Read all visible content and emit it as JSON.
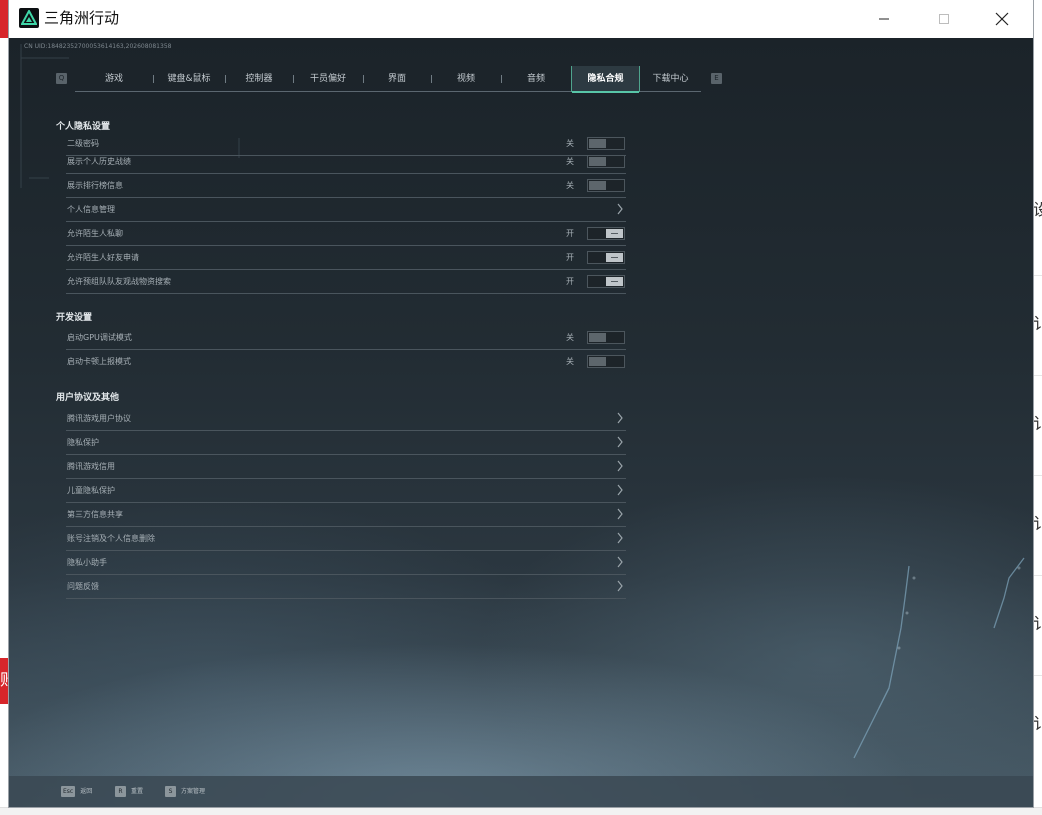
{
  "window": {
    "title": "三角洲行动",
    "uid_text": "CN UID:18482352700053614163,202608081358"
  },
  "background_app": {
    "left_glyph": "败",
    "right_glyphs": [
      "设",
      "讠",
      "讠",
      "讠",
      "讠",
      "讠"
    ]
  },
  "tabs": {
    "prev_key": "Q",
    "next_key": "E",
    "items": [
      {
        "label": "游戏"
      },
      {
        "label": "键盘&鼠标"
      },
      {
        "label": "控制器"
      },
      {
        "label": "干员偏好"
      },
      {
        "label": "界面"
      },
      {
        "label": "视频"
      },
      {
        "label": "音频"
      },
      {
        "label": "隐私合规",
        "active": true
      },
      {
        "label": "下载中心"
      }
    ]
  },
  "sections": {
    "privacy": {
      "title": "个人隐私设置",
      "rows": [
        {
          "label": "二级密码",
          "state": "关",
          "control": "toggle",
          "on": false
        },
        {
          "label": "展示个人历史战绩",
          "state": "关",
          "control": "toggle",
          "on": false
        },
        {
          "label": "展示排行榜信息",
          "state": "关",
          "control": "toggle",
          "on": false
        },
        {
          "label": "个人信息管理",
          "control": "link"
        },
        {
          "label": "允许陌生人私聊",
          "state": "开",
          "control": "toggle",
          "on": true
        },
        {
          "label": "允许陌生人好友申请",
          "state": "开",
          "control": "toggle",
          "on": true
        },
        {
          "label": "允许预组队队友观战物资搜索",
          "state": "开",
          "control": "toggle",
          "on": true
        }
      ]
    },
    "developer": {
      "title": "开发设置",
      "rows": [
        {
          "label": "启动GPU调试模式",
          "state": "关",
          "control": "toggle",
          "on": false
        },
        {
          "label": "启动卡顿上报模式",
          "state": "关",
          "control": "toggle",
          "on": false
        }
      ]
    },
    "agreements": {
      "title": "用户协议及其他",
      "rows": [
        {
          "label": "腾讯游戏用户协议",
          "control": "link"
        },
        {
          "label": "隐私保护",
          "control": "link"
        },
        {
          "label": "腾讯游戏信用",
          "control": "link"
        },
        {
          "label": "儿童隐私保护",
          "control": "link"
        },
        {
          "label": "第三方信息共享",
          "control": "link"
        },
        {
          "label": "账号注销及个人信息删除",
          "control": "link"
        },
        {
          "label": "隐私小助手",
          "control": "link"
        },
        {
          "label": "问题反馈",
          "control": "link"
        }
      ]
    }
  },
  "bottom_bar": {
    "hints": [
      {
        "key": "Esc",
        "label": "返回"
      },
      {
        "key": "R",
        "label": "重置"
      },
      {
        "key": "S",
        "label": "方案管理"
      }
    ]
  },
  "colors": {
    "accent": "#58c6a8",
    "panel_bg": "#1e272e",
    "text_primary": "#e2e7ea",
    "text_secondary": "#a7b0b6",
    "background_red": "#d7262b"
  },
  "icons": {
    "app_logo": "triangle-logo-icon",
    "row_link": "chevron-right-icon",
    "window_controls": [
      "minimize-icon",
      "maximize-icon",
      "close-icon"
    ]
  }
}
